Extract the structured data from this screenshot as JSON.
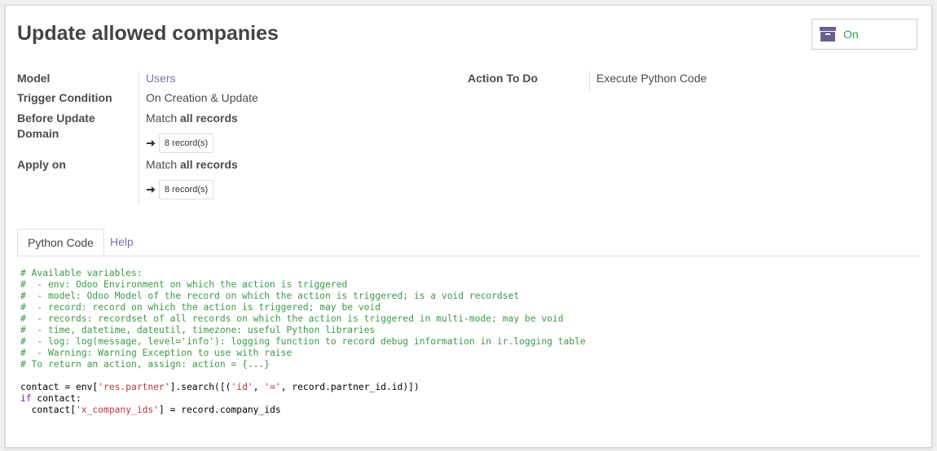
{
  "header": {
    "title": "Update allowed companies",
    "archive_state": "On",
    "archive_icon": "archive-box-icon"
  },
  "form": {
    "model_label": "Model",
    "model_value": "Users",
    "trigger_label": "Trigger Condition",
    "trigger_value": "On Creation & Update",
    "before_domain_label_1": "Before Update",
    "before_domain_label_2": "Domain",
    "before_domain_prefix": "Match",
    "before_domain_emph": "all records",
    "before_domain_records": "8 record(s)",
    "apply_label": "Apply on",
    "apply_prefix": "Match",
    "apply_emph": "all records",
    "apply_records": "8 record(s)",
    "action_label": "Action To Do",
    "action_value": "Execute Python Code"
  },
  "tabs": [
    {
      "label": "Python Code",
      "active": true
    },
    {
      "label": "Help",
      "active": false
    }
  ],
  "code": {
    "comments": [
      "# Available variables:",
      "#  - env: Odoo Environment on which the action is triggered",
      "#  - model: Odoo Model of the record on which the action is triggered; is a void recordset",
      "#  - record: record on which the action is triggered; may be void",
      "#  - records: recordset of all records on which the action is triggered in multi-mode; may be void",
      "#  - time, datetime, dateutil, timezone: useful Python libraries",
      "#  - log: log(message, level='info'): logging function to record debug information in ir.logging table",
      "#  - Warning: Warning Exception to use with raise",
      "# To return an action, assign: action = {...}"
    ],
    "line1_a": "contact = env[",
    "line1_str": "'res.partner'",
    "line1_b": "].search([(",
    "line1_str2": "'id'",
    "line1_c": ", ",
    "line1_str3": "'='",
    "line1_d": ", record.partner_id.id)])",
    "line2_kw": "if",
    "line2_rest": " contact:",
    "line3_a": "  contact[",
    "line3_str": "'x_company_ids'",
    "line3_b": "] = record.company_ids"
  },
  "colors": {
    "accent": "#7c6fa8",
    "on_state": "#28a745",
    "comment": "#3c9a45",
    "string": "#b33a3a",
    "keyword": "#7a1fa2"
  }
}
